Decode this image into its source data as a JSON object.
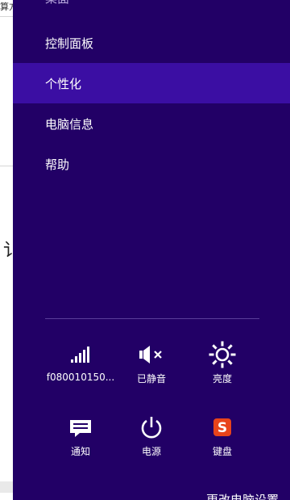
{
  "background_window": {
    "top_text": "算方",
    "mid_char": "讠"
  },
  "settings_pane": {
    "menu": [
      {
        "label": "桌面"
      },
      {
        "label": "控制面板"
      },
      {
        "label": "个性化",
        "selected": true
      },
      {
        "label": "电脑信息"
      },
      {
        "label": "帮助"
      }
    ],
    "quick_settings": [
      {
        "label": "f080010150...",
        "icon": "wifi-signal-icon"
      },
      {
        "label": "已静音",
        "icon": "speaker-muted-icon"
      },
      {
        "label": "亮度",
        "icon": "brightness-icon"
      },
      {
        "label": "通知",
        "icon": "notifications-icon"
      },
      {
        "label": "电源",
        "icon": "power-icon"
      },
      {
        "label": "键盘",
        "icon": "sogou-input-icon"
      }
    ],
    "bottom_link": "更改电脑设置"
  },
  "colors": {
    "pane_bg": "#220066",
    "selected_bg": "#3b0ea3",
    "sogou_orange": "#e8441b"
  }
}
